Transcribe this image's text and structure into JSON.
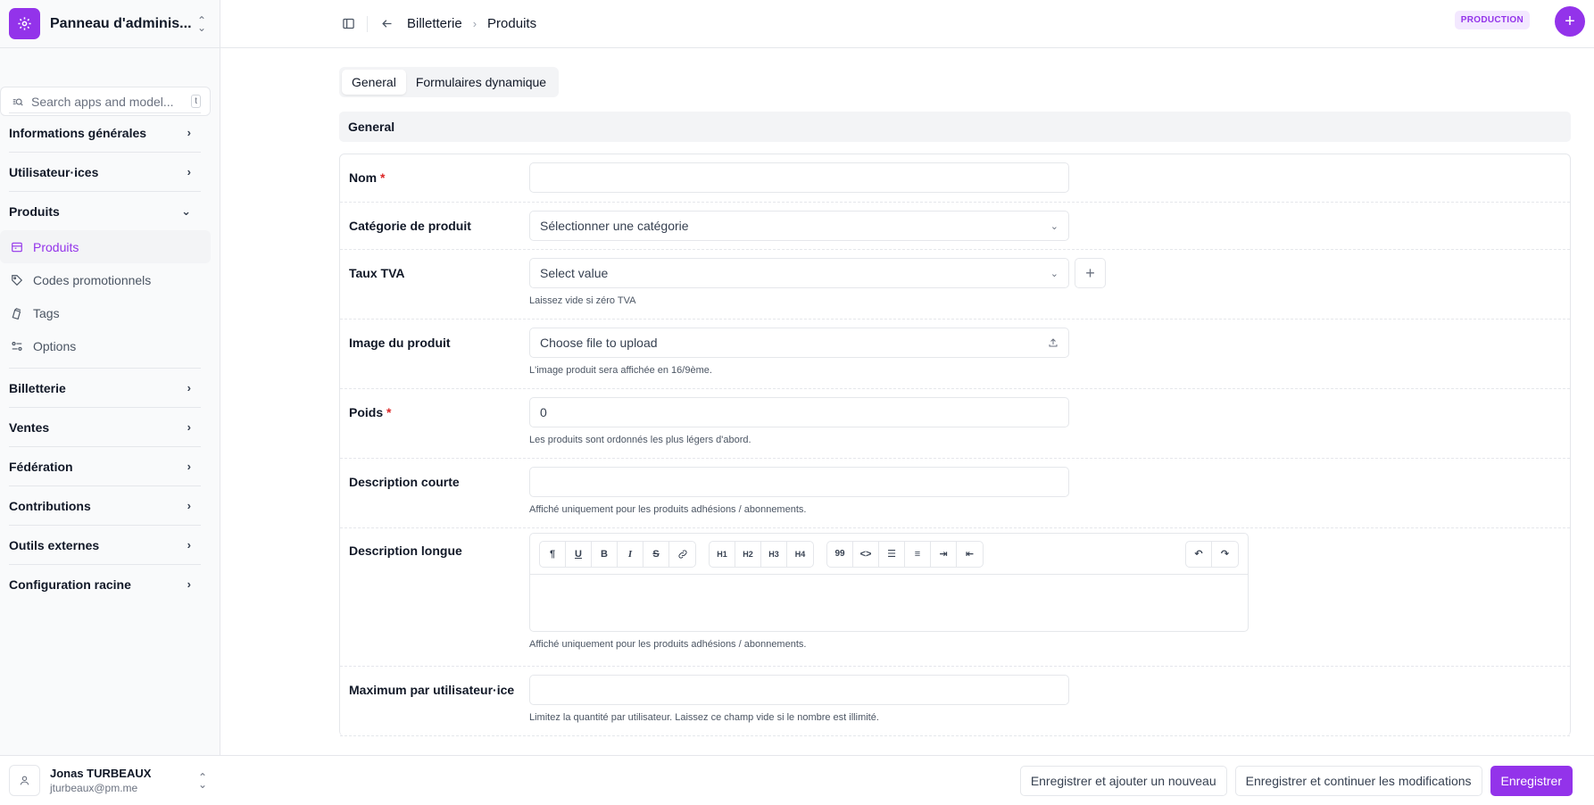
{
  "brand": {
    "title": "Panneau d'adminis..."
  },
  "search": {
    "placeholder": "Search apps and model...",
    "shortcut": "t"
  },
  "nav": {
    "groups": [
      {
        "label": "Informations générales"
      },
      {
        "label": "Utilisateur·ices"
      },
      {
        "label": "Produits"
      },
      {
        "label": "Billetterie"
      },
      {
        "label": "Ventes"
      },
      {
        "label": "Fédération"
      },
      {
        "label": "Contributions"
      },
      {
        "label": "Outils externes"
      },
      {
        "label": "Configuration racine"
      }
    ],
    "produits_items": [
      {
        "label": "Produits",
        "icon": "store-icon",
        "active": true
      },
      {
        "label": "Codes promotionnels",
        "icon": "tag-icon"
      },
      {
        "label": "Tags",
        "icon": "tags-icon"
      },
      {
        "label": "Options",
        "icon": "options-icon"
      }
    ]
  },
  "user": {
    "name": "Jonas TURBEAUX",
    "email": "jturbeaux@pm.me"
  },
  "header": {
    "breadcrumb_parent": "Billetterie",
    "breadcrumb_current": "Produits",
    "env_badge": "PRODUCTION"
  },
  "tabs": [
    {
      "label": "General"
    },
    {
      "label": "Formulaires dynamique"
    }
  ],
  "section": {
    "title": "General"
  },
  "form": {
    "nom": {
      "label": "Nom",
      "value": ""
    },
    "categorie": {
      "label": "Catégorie de produit",
      "value": "Sélectionner une catégorie"
    },
    "tva": {
      "label": "Taux TVA",
      "value": "Select value",
      "help": "Laissez vide si zéro TVA"
    },
    "image": {
      "label": "Image du produit",
      "value": "Choose file to upload",
      "help": "L'image produit sera affichée en 16/9ème."
    },
    "poids": {
      "label": "Poids",
      "value": "0",
      "help": "Les produits sont ordonnés les plus légers d'abord."
    },
    "desc_courte": {
      "label": "Description courte",
      "value": "",
      "help": "Affiché uniquement pour les produits adhésions / abonnements."
    },
    "desc_longue": {
      "label": "Description longue",
      "help": "Affiché uniquement pour les produits adhésions / abonnements."
    },
    "max_user": {
      "label": "Maximum par utilisateur·ice",
      "value": "",
      "help": "Limitez la quantité par utilisateur. Laissez ce champ vide si le nombre est illimité."
    }
  },
  "editor": {
    "toolbar": {
      "group1": [
        "¶",
        "U",
        "B",
        "I",
        "S",
        "🔗"
      ],
      "group2": [
        "H1",
        "H2",
        "H3",
        "H4"
      ],
      "group3": [
        "99",
        "<>",
        "☰",
        "≡",
        "⇥",
        "⇤"
      ],
      "history": [
        "↶",
        "↷"
      ]
    }
  },
  "footer": {
    "save_add": "Enregistrer et ajouter un nouveau",
    "save_continue": "Enregistrer et continuer les modifications",
    "save": "Enregistrer"
  }
}
